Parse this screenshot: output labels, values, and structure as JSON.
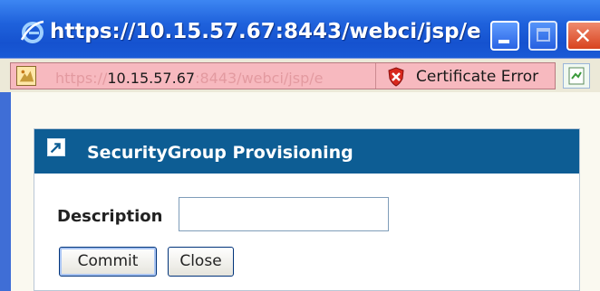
{
  "window": {
    "title": "https://10.15.57.67:8443/webci/jsp/e...",
    "icon": "ie-icon",
    "controls": [
      "minimize-icon",
      "maximize-icon",
      "close-icon"
    ]
  },
  "address_bar": {
    "url_scheme": "https://",
    "url_host": "10.15.57.67",
    "url_rest": ":8443/webci/jsp/e",
    "cert_label": "Certificate Error",
    "bg_color": "#f7b9bf"
  },
  "dialog": {
    "title": "SecurityGroup  Provisioning",
    "header_color": "#0d5d94",
    "description_label": "Description",
    "description_value": "",
    "commit_label": "Commit",
    "close_label": "Close"
  }
}
